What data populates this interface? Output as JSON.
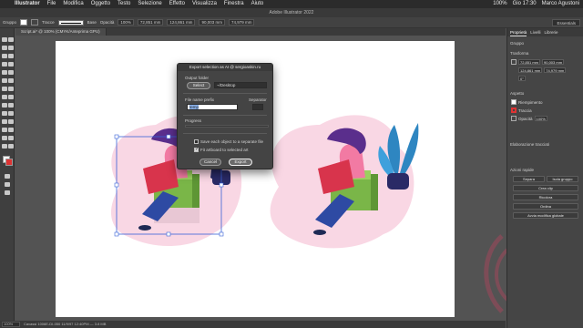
{
  "menubar": {
    "app_name": "Illustrator",
    "items": [
      "File",
      "Modifica",
      "Oggetto",
      "Testo",
      "Selezione",
      "Effetto",
      "Visualizza",
      "Finestra",
      "Aiuto"
    ],
    "status": [
      "100%",
      "Gio 17:30",
      "Marco Agustoni"
    ]
  },
  "window": {
    "title": "Adobe Illustrator 2022"
  },
  "controlbar": {
    "selection_label": "Gruppo",
    "stroke_label": "Tracce",
    "stroke_style": "Base",
    "opacity_label": "Opacità",
    "opacity_value": "100%",
    "x_value": "72,851 mm",
    "y_value": "124,861 mm",
    "w_value": "90,003 mm",
    "h_value": "74,979 mm",
    "workspace": "Essentials"
  },
  "tab": {
    "label": "Script.ai* @ 100% (CMYK/Anteprima GPU)"
  },
  "statusbar": {
    "zoom": "100%",
    "info": "Cavassi 1006E-DI-050 11/9/97 12:40PM — 3.8 MB"
  },
  "dialog": {
    "title": "Export selection as AI @ sergioaskin.ru",
    "output_folder_label": "Output folder",
    "select_button": "Select",
    "output_path": "~/Desktop",
    "prefix_label": "File name prefix",
    "separator_label": "Separator",
    "prefix_value": "temp",
    "progress_label": "Progress",
    "option_save_each": "Save each object to a separate file",
    "option_fit_artboard": "Fit artboard to selected art",
    "option_save_each_checked": false,
    "option_fit_artboard_checked": true,
    "cancel_button": "Cancel",
    "export_button": "Export"
  },
  "rightpanel": {
    "tabs": [
      "Proprietà",
      "Livelli",
      "Librerie"
    ],
    "group_label": "Gruppo",
    "transform_heading": "Trasforma",
    "x": "72,851 mm",
    "y": "124,861 mm",
    "w": "90,003 mm",
    "h": "74,979 mm",
    "angle": "0°",
    "appearance_heading": "Aspetto",
    "fill_label": "Riempimento",
    "stroke_label": "Traccia",
    "opacity_label": "Opacità",
    "opacity_value": "100%",
    "quick_actions_heading": "Azioni rapide",
    "btn_separa": "Separa",
    "btn_isola": "Isola gruppo",
    "btn_crea_clip": "Crea clip",
    "btn_ricolora": "Ricolora",
    "btn_ordina": "Ordina",
    "btn_modifica": "Avvia modifica globale",
    "align_heading": "Elaborazione tracciati"
  },
  "colors": {
    "panel_bg": "#454545",
    "canvas_bg": "#535353",
    "artboard": "#ffffff",
    "pink_blob": "#f9d7e4",
    "selection_blue": "#3a63d8",
    "hair_purple": "#5a2e8c",
    "shirt_pink": "#f27aa3",
    "laptop_red": "#d8344c",
    "cube_green": "#7ab648",
    "jeans_blue": "#2e4aa3",
    "plant_blue": "#2e86c1",
    "pot_navy": "#2a2a66"
  }
}
